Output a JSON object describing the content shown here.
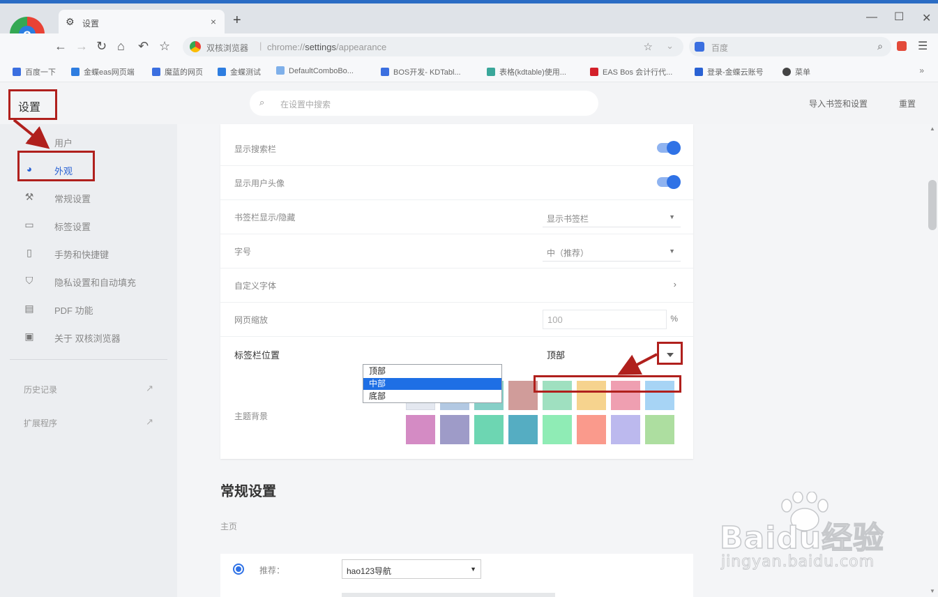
{
  "browser": {
    "tab_title": "设置",
    "site_name": "双核浏览器",
    "url_prefix": "chrome://",
    "url_bold": "settings",
    "url_suffix": "/appearance",
    "search_engine": "百度"
  },
  "bookmarks": [
    {
      "label": "百度一下",
      "color": "#3b6fe0"
    },
    {
      "label": "金蝶eas网页端",
      "color": "#2e7de0"
    },
    {
      "label": "魔蓝的网页",
      "color": "#3b6fe0"
    },
    {
      "label": "金蝶测试",
      "color": "#2e7de0"
    },
    {
      "label": "DefaultComboBo...",
      "color": "#7fb0ea"
    },
    {
      "label": "BOS开发- KDTabl...",
      "color": "#3b6fe0"
    },
    {
      "label": "表格(kdtable)使用...",
      "color": "#3aa79a"
    },
    {
      "label": "EAS Bos 会计行代...",
      "color": "#d3202a"
    },
    {
      "label": "登录-金蝶云账号",
      "color": "#2a62d4"
    },
    {
      "label": "菜单",
      "color": "#444444"
    }
  ],
  "header": {
    "title": "设置",
    "search_placeholder": "在设置中搜索",
    "import_label": "导入书签和设置",
    "reset_label": "重置"
  },
  "sidebar": {
    "items": [
      {
        "label": "用户",
        "icon": "user-icon"
      },
      {
        "label": "外观",
        "icon": "palette-icon",
        "active": true
      },
      {
        "label": "常规设置",
        "icon": "wrench-icon"
      },
      {
        "label": "标签设置",
        "icon": "tab-icon"
      },
      {
        "label": "手势和快捷键",
        "icon": "mouse-icon"
      },
      {
        "label": "隐私设置和自动填充",
        "icon": "shield-icon"
      },
      {
        "label": "PDF 功能",
        "icon": "pdf-icon"
      },
      {
        "label": "关于 双核浏览器",
        "icon": "info-icon"
      }
    ],
    "links": [
      {
        "label": "历史记录"
      },
      {
        "label": "扩展程序"
      }
    ]
  },
  "appearance": {
    "rows": [
      {
        "label": "显示搜索栏",
        "type": "toggle",
        "on": true
      },
      {
        "label": "显示用户头像",
        "type": "toggle",
        "on": true
      },
      {
        "label": "书签栏显示/隐藏",
        "type": "select",
        "value": "显示书签栏"
      },
      {
        "label": "字号",
        "type": "select",
        "value": "中（推荐）"
      },
      {
        "label": "自定义字体",
        "type": "link"
      },
      {
        "label": "网页缩放",
        "type": "number",
        "value": "100",
        "unit": "%"
      }
    ],
    "tab_position": {
      "label": "标签栏位置",
      "value": "顶部",
      "options": [
        "顶部",
        "中部",
        "底部"
      ],
      "highlighted": "中部"
    },
    "theme": {
      "label": "主题背景",
      "swatches_row1": [
        "#e4e8f0",
        "#b2c8e2",
        "#86cfc7",
        "#d09c9a",
        "#9fe0c0",
        "#f6d38e",
        "#ef9fb1",
        "#a7d4f5"
      ],
      "swatches_row2": [
        "#d48bc4",
        "#9e9bc8",
        "#6dd6b2",
        "#55adc2",
        "#8fecb5",
        "#fa9a8c",
        "#bcb9ee",
        "#addea0"
      ]
    }
  },
  "general": {
    "section_title": "常规设置",
    "homepage_label": "主页",
    "recommend_label": "推荐：",
    "nav_select_value": "hao123导航"
  },
  "watermark": {
    "brand": "Baidu经验",
    "domain": "jingyan.baidu.com"
  },
  "colors": {
    "accent": "#2f72e6",
    "annotation_red": "#b0201d",
    "selected_option": "#1e6fe5"
  }
}
